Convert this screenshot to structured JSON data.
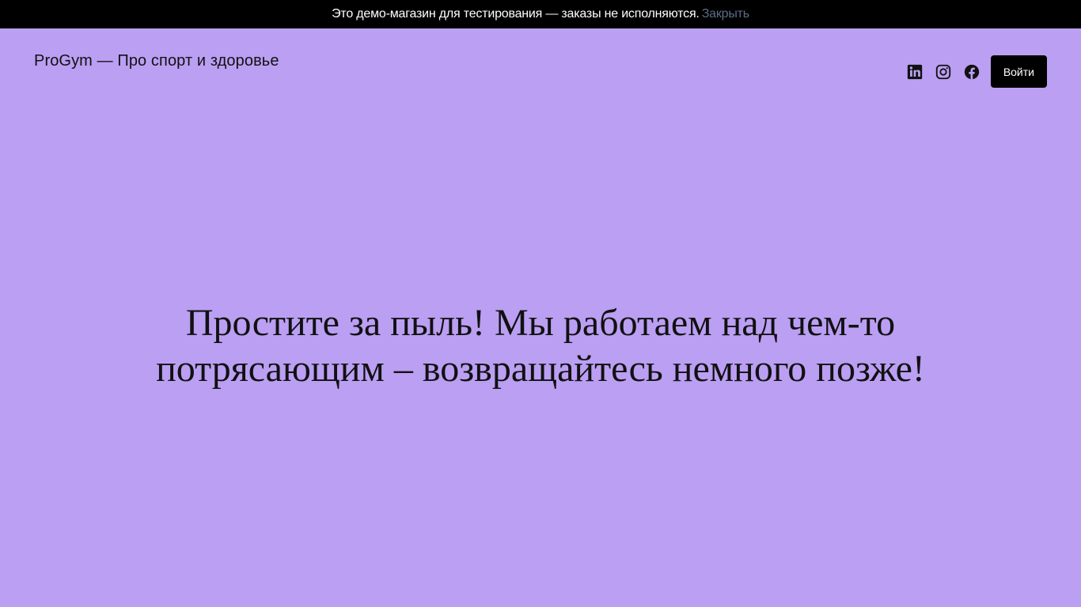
{
  "notice": {
    "text": "Это демо-магазин для тестирования — заказы не исполняются.",
    "dismiss_label": "Закрыть"
  },
  "header": {
    "site_title": "ProGym — Про спорт и здоровье",
    "social": [
      {
        "icon": "linkedin-icon"
      },
      {
        "icon": "instagram-icon"
      },
      {
        "icon": "facebook-icon"
      }
    ],
    "login_label": "Войти"
  },
  "main": {
    "message": "Простите за пыль! Мы работаем над чем-то потрясающим – возвращайтесь немного позже!"
  },
  "colors": {
    "background": "#bb9ff3",
    "notice_bg": "#000000",
    "dismiss_link": "#5b6b86",
    "button_bg": "#000000"
  }
}
